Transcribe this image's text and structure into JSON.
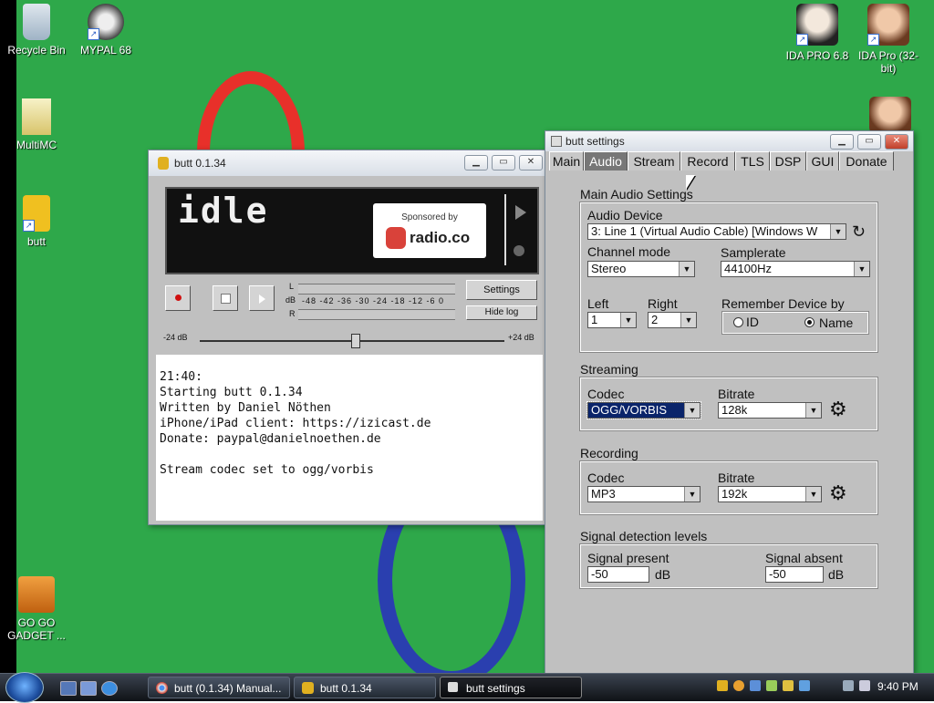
{
  "desktop": {
    "icons_left": [
      {
        "label": "Recycle Bin"
      },
      {
        "label": "MYPAL 68"
      },
      {
        "label": "MultiMC"
      },
      {
        "label": "butt"
      },
      {
        "label": "GO GO GADGET ..."
      }
    ],
    "icons_right": [
      {
        "label": "IDA PRO 6.8"
      },
      {
        "label": "IDA Pro (32-bit)"
      }
    ]
  },
  "butt_window": {
    "title": "butt 0.1.34",
    "display_status": "idle",
    "sponsor_text": "Sponsored by",
    "sponsor_name": "radio.co",
    "settings_button": "Settings",
    "hide_log_button": "Hide log",
    "meter_left": "L",
    "meter_db": "dB",
    "meter_right": "R",
    "meter_scale": "-48  -42  -36  -30  -24  -18  -12  -6  0",
    "gain_min": "-24 dB",
    "gain_max": "+24 dB",
    "log_text": "21:40:\nStarting butt 0.1.34\nWritten by Daniel Nöthen\niPhone/iPad client: https://izicast.de\nDonate: paypal@danielnoethen.de\n\nStream codec set to ogg/vorbis"
  },
  "settings_window": {
    "title": "butt settings",
    "tabs": [
      "Main",
      "Audio",
      "Stream",
      "Record",
      "TLS",
      "DSP",
      "GUI",
      "Donate"
    ],
    "active_tab": "Audio",
    "main_audio": {
      "title": "Main Audio Settings",
      "audio_device_label": "Audio Device",
      "audio_device_value": "3: Line 1 (Virtual Audio Cable) [Windows W",
      "channel_mode_label": "Channel mode",
      "channel_mode_value": "Stereo",
      "samplerate_label": "Samplerate",
      "samplerate_value": "44100Hz",
      "left_label": "Left",
      "left_value": "1",
      "right_label": "Right",
      "right_value": "2",
      "remember_label": "Remember Device by",
      "remember_id": "ID",
      "remember_name": "Name"
    },
    "streaming": {
      "title": "Streaming",
      "codec_label": "Codec",
      "codec_value": "OGG/VORBIS",
      "bitrate_label": "Bitrate",
      "bitrate_value": "128k"
    },
    "recording": {
      "title": "Recording",
      "codec_label": "Codec",
      "codec_value": "MP3",
      "bitrate_label": "Bitrate",
      "bitrate_value": "192k"
    },
    "signal": {
      "title": "Signal detection levels",
      "present_label": "Signal present",
      "present_value": "-50",
      "absent_label": "Signal absent",
      "absent_value": "-50",
      "unit": "dB"
    }
  },
  "taskbar": {
    "tasks": [
      {
        "label": "butt (0.1.34) Manual..."
      },
      {
        "label": "butt 0.1.34"
      },
      {
        "label": "butt settings"
      }
    ],
    "clock": "9:40 PM"
  },
  "colors": {
    "desktop_bg": "#2ea84a",
    "window_bg": "#c0c0c0",
    "selection": "#0a246a"
  }
}
